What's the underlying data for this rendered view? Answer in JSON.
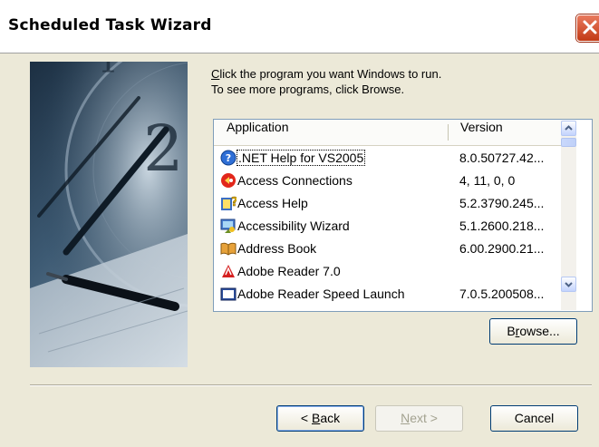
{
  "window": {
    "title": "Scheduled Task Wizard",
    "close_icon": "close-icon",
    "accent_color": "#0054e3"
  },
  "instructions": {
    "line1_key": "C",
    "line1_rest": "lick the program you want Windows to run.",
    "line2": "To see more programs, click Browse."
  },
  "list": {
    "columns": [
      "Application",
      "Version"
    ],
    "rows": [
      {
        "name": ".NET Help for VS2005",
        "version": "8.0.50727.42...",
        "icon": "help-globe-icon"
      },
      {
        "name": "Access Connections",
        "version": "4, 11, 0, 0",
        "icon": "access-connections-icon"
      },
      {
        "name": "Access Help",
        "version": "5.2.3790.245...",
        "icon": "help-book-icon"
      },
      {
        "name": "Accessibility Wizard",
        "version": "5.1.2600.218...",
        "icon": "accessibility-wizard-icon"
      },
      {
        "name": "Address Book",
        "version": "6.00.2900.21...",
        "icon": "address-book-icon"
      },
      {
        "name": "Adobe Reader 7.0",
        "version": "",
        "icon": "adobe-reader-icon"
      },
      {
        "name": "Adobe Reader Speed Launch",
        "version": "7.0.5.200508...",
        "icon": "adobe-speed-launch-icon"
      }
    ]
  },
  "buttons": {
    "browse": {
      "pre": "B",
      "key": "r",
      "post": "owse..."
    },
    "back": {
      "pre": "< ",
      "key": "B",
      "post": "ack"
    },
    "next": {
      "pre": "",
      "key": "N",
      "post": "ext >"
    },
    "cancel": "Cancel"
  }
}
